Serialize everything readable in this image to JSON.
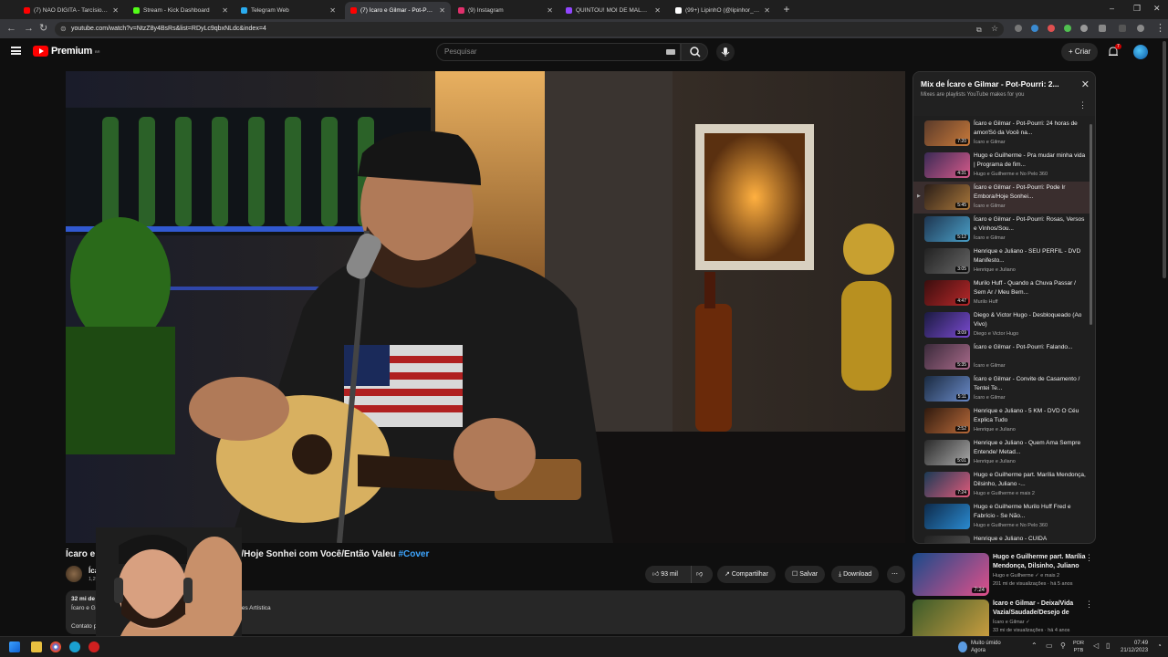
{
  "browser": {
    "tabs": [
      {
        "label": "(7) NÃO DIGITA - Tarcísio do Ac",
        "color": "#ff0000",
        "active": false
      },
      {
        "label": "Stream - Kick Dashboard",
        "color": "#53fc18",
        "active": false
      },
      {
        "label": "Telegram Web",
        "color": "#2aabee",
        "active": false
      },
      {
        "label": "(7) Ícaro e Gilmar - Pot-Pourri: P",
        "color": "#ff0000",
        "active": true
      },
      {
        "label": "(9) Instagram",
        "color": "#e1306c",
        "active": false
      },
      {
        "label": "QUINTOU! MOI DE MALOKEIR",
        "color": "#9146ff",
        "active": false
      },
      {
        "label": "(99+) LipinhO (@lipinhor_) | Tik",
        "color": "#ffffff",
        "active": false
      }
    ],
    "url": "youtube.com/watch?v=NtzZ8y4BsRs&list=RDyLc9qbxNLdc&index=4"
  },
  "yt": {
    "logo_text": "Premium",
    "logo_sup": "BR",
    "search_placeholder": "Pesquisar",
    "create_label": "Criar",
    "notif_count": "7"
  },
  "video": {
    "title": "Ícaro e Gilmar - Pot-Pourri: Pode Ir Embora/Hoje Sonhei com Você/Então Valeu",
    "hashtag": "#Cover",
    "title_visible_left": "Ícaro e Gilmar",
    "title_visible_right": "bora/Hoje Sonhei com Você/Então Valeu",
    "channel": "Ícaro e",
    "subs": "1,29 m",
    "likes": "93 mil",
    "share": "Compartilhar",
    "save": "Salvar",
    "download": "Download",
    "desc_views": "32 mi de v",
    "desc_line2": "Ícaro e Gilm",
    "desc_line2b": "ções Artística",
    "desc_contact": "Contato p"
  },
  "playlist": {
    "title": "Mix de Ícaro e Gilmar - Pot-Pourri: 2...",
    "subtitle": "Mixes are playlists YouTube makes for you",
    "items": [
      {
        "title": "Ícaro e Gilmar - Pot-Pourri: 24 horas de amor/Só da Você na...",
        "channel": "Ícaro e Gilmar",
        "duration": "7:20",
        "c1": "#5a3a2a",
        "c2": "#c97a3a",
        "current": false
      },
      {
        "title": "Hugo e Guilherme - Pra mudar minha vida | Programa de fim...",
        "channel": "Hugo e Guilherme e No Pelo 360",
        "duration": "4:31",
        "c1": "#3a2a55",
        "c2": "#d65a8a",
        "current": false
      },
      {
        "title": "Ícaro e Gilmar - Pot-Pourri: Pode Ir Embora/Hoje Sonhei...",
        "channel": "Ícaro e Gilmar",
        "duration": "5:45",
        "c1": "#2a1e18",
        "c2": "#a8763a",
        "current": true
      },
      {
        "title": "Ícaro e Gilmar - Pot-Pourri: Rosas, Versos e Vinhos/Sou...",
        "channel": "Ícaro e Gilmar",
        "duration": "5:12",
        "c1": "#1e3550",
        "c2": "#4aa0c8",
        "current": false
      },
      {
        "title": "Henrique e Juliano - SEU PERFIL - DVD Manifesto...",
        "channel": "Henrique e Juliano",
        "duration": "3:05",
        "c1": "#222",
        "c2": "#666",
        "current": false
      },
      {
        "title": "Murilo Huff - Quando a Chuva Passar / Sem Ar / Meu Bem...",
        "channel": "Murilo Huff",
        "duration": "4:47",
        "c1": "#3a0e0e",
        "c2": "#b8282a",
        "current": false
      },
      {
        "title": "Diego & Victor Hugo - Desbloqueado (Ao Vivo)",
        "channel": "Diego e Victor Hugo",
        "duration": "3:09",
        "c1": "#1a1a40",
        "c2": "#7a4ad0",
        "current": false
      },
      {
        "title": "Ícaro e Gilmar - Pot-Pourri: Falando...",
        "channel": "Ícaro e Gilmar",
        "duration": "5:35",
        "c1": "#3a2a3a",
        "c2": "#a86a8a",
        "current": false
      },
      {
        "title": "Ícaro e Gilmar - Convite de Casamento / Tentei Te...",
        "channel": "Ícaro e Gilmar",
        "duration": "5:11",
        "c1": "#1a2a40",
        "c2": "#6a8ac8",
        "current": false
      },
      {
        "title": "Henrique e Juliano - 5 KM - DVD O Céu Explica Tudo",
        "channel": "Henrique e Juliano",
        "duration": "2:52",
        "c1": "#301a0e",
        "c2": "#b86a3a",
        "current": false
      },
      {
        "title": "Henrique e Juliano - Quem Ama Sempre Entende/ Metad...",
        "channel": "Henrique e Juliano",
        "duration": "5:01",
        "c1": "#2a2a2a",
        "c2": "#aaa",
        "current": false
      },
      {
        "title": "Hugo e Guilherme part. Marília Mendonça, Dilsinho, Juliano -...",
        "channel": "Hugo e Guilherme e mais 2",
        "duration": "7:24",
        "c1": "#1a3a55",
        "c2": "#e05a7a",
        "current": false
      },
      {
        "title": "Hugo e Guilherme Murilo Huff Fred e Fabrício - Se Não...",
        "channel": "Hugo e Guilherme e No Pelo 360",
        "duration": "",
        "c1": "#0e2a4a",
        "c2": "#2a8ad0",
        "current": false
      },
      {
        "title": "Henrique e Juliano - CUIDA",
        "channel": "",
        "duration": "",
        "c1": "#222",
        "c2": "#555",
        "current": false
      }
    ]
  },
  "recs": [
    {
      "title": "Hugo e Guilherme part. Marília Mendonça, Dilsinho, Juliano -...",
      "channel": "Hugo e Guilherme ✓ e mais 2",
      "views": "201 mi de visualizações · há 5 anos",
      "duration": "7:24",
      "c1": "#1a4a8a",
      "c2": "#e0508a"
    },
    {
      "title": "Ícaro e Gilmar - Deixa/Vida Vazia/Saudade/Desejo de Am...",
      "channel": "Ícaro e Gilmar ✓",
      "views": "33 mi de visualizações · há 4 anos",
      "duration": "",
      "c1": "#3a5a2a",
      "c2": "#d0a040"
    }
  ],
  "taskbar": {
    "weather_line1": "Muito úmido",
    "weather_line2": "Agora",
    "lang1": "POR",
    "lang2": "PTB",
    "time": "07:49",
    "date": "21/12/2023"
  },
  "icons": [
    "menu-icon",
    "search-icon",
    "mic-icon",
    "bell-icon",
    "like-icon",
    "dislike-icon",
    "share-icon",
    "save-icon",
    "download-icon",
    "more-icon",
    "close-icon"
  ]
}
